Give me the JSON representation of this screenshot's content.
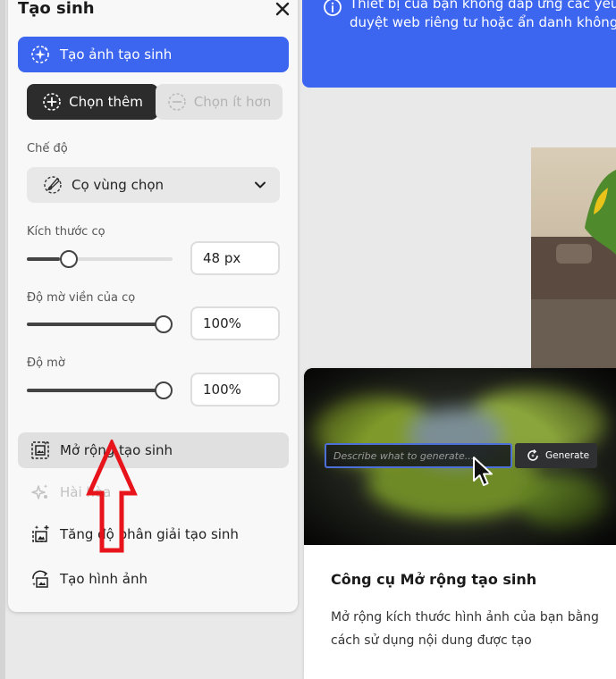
{
  "panel": {
    "title": "Tạo sinh",
    "primary_action": "Tạo ảnh tạo sinh",
    "add_label": "Chọn thêm",
    "subtract_label": "Chọn ít hơn",
    "mode_label": "Chế độ",
    "mode_value": "Cọ vùng chọn",
    "brush_size_label": "Kích thước cọ",
    "brush_size_value": "48 px",
    "brush_size_percent": 29,
    "edge_blur_label": "Độ mờ viền của cọ",
    "edge_blur_value": "100%",
    "edge_blur_percent": 100,
    "opacity_label": "Độ mờ",
    "opacity_value": "100%",
    "opacity_percent": 100,
    "menu": [
      {
        "label": "Mở rộng tạo sinh"
      },
      {
        "label": "Hài hòa"
      },
      {
        "label": "Tăng độ phân giải tạo sinh"
      },
      {
        "label": "Tạo hình ảnh"
      }
    ]
  },
  "banner": {
    "line1": "Thiết bị của bạn không đáp ứng các yêu cầu",
    "line2": "duyệt web riêng tư hoặc ẩn danh không đư"
  },
  "card": {
    "input_placeholder": "Describe what to generate...",
    "generate_label": "Generate",
    "title": "Công cụ Mở rộng tạo sinh",
    "description": "Mở rộng kích thước hình ảnh của bạn bằng cách sử dụng nội dung được tạo"
  },
  "colors": {
    "accent": "#3d66f0",
    "annotation": "#e8141b"
  }
}
